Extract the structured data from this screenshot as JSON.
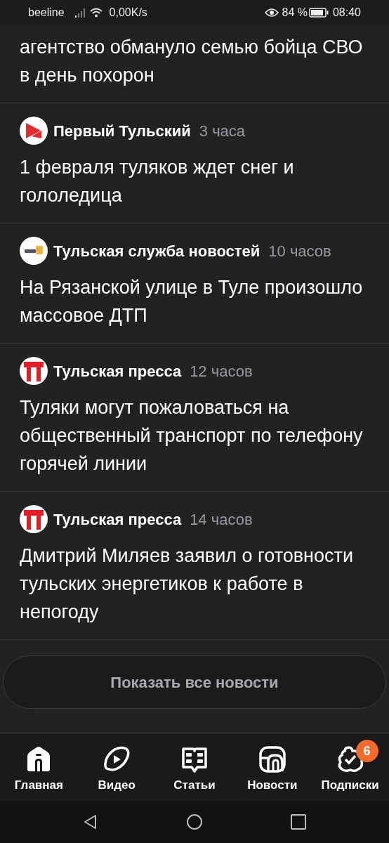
{
  "status_bar": {
    "carrier": "beeline",
    "speed": "0,00K/s",
    "battery": "84 %",
    "time": "08:40"
  },
  "news": [
    {
      "headline": "агентство обмануло семью бойца СВО в день похорон"
    },
    {
      "kind": "arrow",
      "source": "Первый Тульский",
      "time": "3 часа",
      "headline": "1 февраля туляков ждет снег и гололедица"
    },
    {
      "kind": "tsn",
      "source": "Тульская служба новостей",
      "time": "10 часов",
      "headline": "На Рязанской улице в Туле произошло массовое ДТП"
    },
    {
      "kind": "t",
      "source": "Тульская пресса",
      "time": "12 часов",
      "headline": "Туляки могут пожаловаться на общественный транспорт по телефону горячей линии"
    },
    {
      "kind": "t",
      "source": "Тульская пресса",
      "time": "14 часов",
      "headline": "Дмитрий Миляев заявил о готовности тульских энергетиков к работе в непогоду"
    }
  ],
  "show_all_button": "Показать все новости",
  "nav": [
    {
      "label": "Главная"
    },
    {
      "label": "Видео"
    },
    {
      "label": "Статьи"
    },
    {
      "label": "Новости"
    },
    {
      "label": "Подписки",
      "badge": "6"
    }
  ]
}
